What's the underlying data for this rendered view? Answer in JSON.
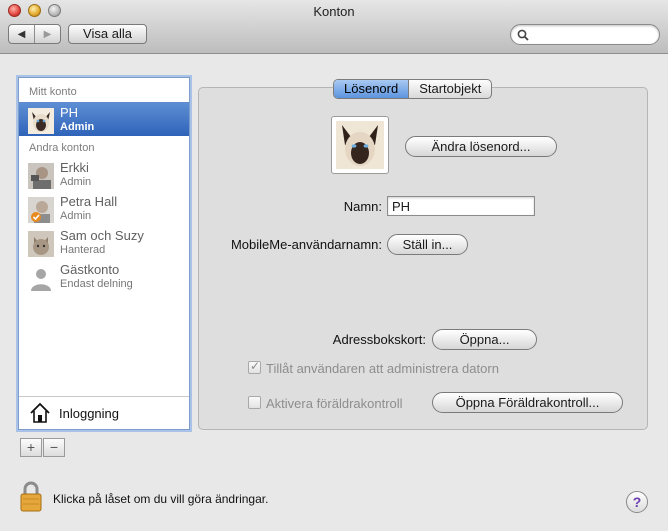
{
  "window": {
    "title": "Konton"
  },
  "toolbar": {
    "back_glyph": "◀",
    "forward_glyph": "▶",
    "show_all_label": "Visa alla",
    "search_placeholder": ""
  },
  "sidebar": {
    "my_account_header": "Mitt konto",
    "other_accounts_header": "Andra konton",
    "my_account": {
      "name": "PH",
      "role": "Admin",
      "icon": "siamese-cat-icon"
    },
    "other_accounts": [
      {
        "name": "Erkki",
        "role": "Admin",
        "icon": "user-photo-icon"
      },
      {
        "name": "Petra Hall",
        "role": "Admin",
        "icon": "user-photo-icon"
      },
      {
        "name": "Sam och Suzy",
        "role": "Hanterad",
        "icon": "cat-photo-icon"
      },
      {
        "name": "Gästkonto",
        "role": "Endast delning",
        "icon": "guest-silhouette-icon"
      }
    ],
    "login_options_label": "Inloggning",
    "add_label": "+",
    "remove_label": "−"
  },
  "tabs": [
    {
      "label": "Lösenord",
      "active": true
    },
    {
      "label": "Startobjekt",
      "active": false
    }
  ],
  "password_pane": {
    "change_password_label": "Ändra lösenord...",
    "name_label": "Namn:",
    "name_value": "PH",
    "mobileme_label": "MobileMe-användarnamn:",
    "mobileme_button": "Ställ in...",
    "address_card_label": "Adressbokskort:",
    "address_card_button": "Öppna...",
    "allow_admin_label": "Tillåt användaren att administrera datorn",
    "allow_admin_checked": true,
    "parental_controls_label": "Aktivera föräldrakontroll",
    "parental_controls_checked": false,
    "open_parental_controls_button": "Öppna Föräldrakontroll..."
  },
  "footer": {
    "lock_text": "Klicka på låset om du vill göra ändringar.",
    "help_label": "?"
  },
  "colors": {
    "selection": "#2f63b9",
    "tab_active": "#5c93de"
  }
}
